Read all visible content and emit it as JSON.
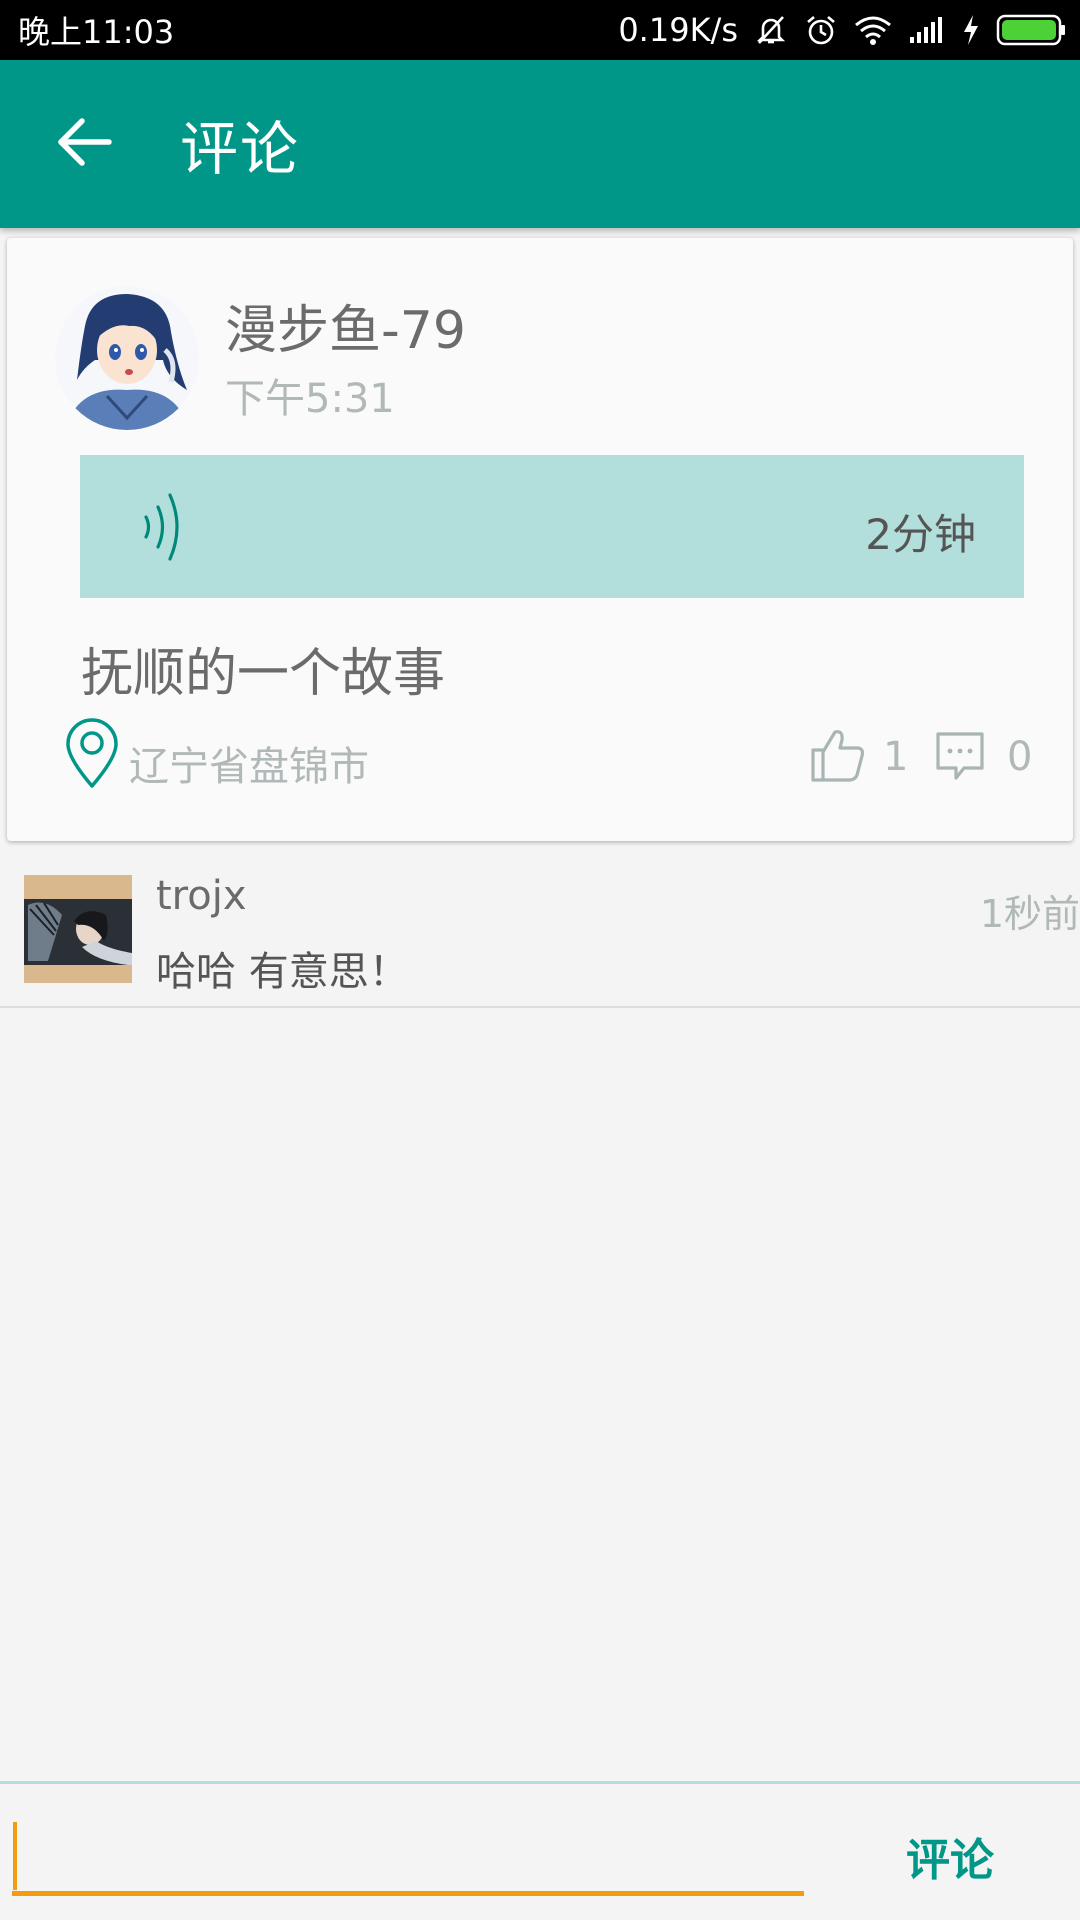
{
  "status_bar": {
    "time": "晚上11:03",
    "network_speed": "0.19K/s",
    "icons": [
      "mute-icon",
      "alarm-icon",
      "wifi-icon",
      "signal-icon",
      "charging-icon",
      "battery-icon"
    ]
  },
  "app_bar": {
    "back_icon": "back-arrow-icon",
    "title": "评论"
  },
  "post": {
    "username": "漫步鱼-79",
    "time": "下午5:31",
    "voice": {
      "icon": "voice-wave-icon",
      "duration": "2分钟"
    },
    "text": "抚顺的一个故事",
    "location": "辽宁省盘锦市",
    "likes": "1",
    "comments": "0"
  },
  "comments": [
    {
      "username": "trojx",
      "time": "1秒前",
      "text": "哈哈 有意思！"
    }
  ],
  "input_bar": {
    "placeholder": "",
    "send_label": "评论"
  },
  "colors": {
    "primary": "#009688",
    "voice_bg": "#b2dfdb",
    "input_accent": "#f39c12",
    "battery": "#4cd137"
  }
}
